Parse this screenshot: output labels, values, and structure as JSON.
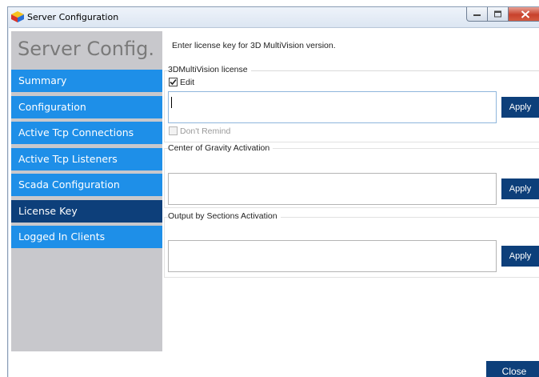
{
  "window": {
    "title": "Server Configuration"
  },
  "sidebar": {
    "title": "Server Config.",
    "items": [
      {
        "label": "Summary"
      },
      {
        "label": "Configuration"
      },
      {
        "label": "Active Tcp Connections"
      },
      {
        "label": "Active Tcp Listeners"
      },
      {
        "label": "Scada Configuration"
      },
      {
        "label": "License Key",
        "active": true
      },
      {
        "label": "Logged In Clients"
      }
    ]
  },
  "main": {
    "intro": "Enter license key for 3D MultiVision version.",
    "license_group": {
      "title": "3DMultiVision license",
      "edit_label": "Edit",
      "edit_checked": true,
      "license_value": "",
      "apply_label": "Apply",
      "dont_remind_label": "Don't Remind",
      "dont_remind_checked": false
    },
    "cog_group": {
      "title": "Center of Gravity Activation",
      "value": "",
      "apply_label": "Apply"
    },
    "output_group": {
      "title": "Output by Sections Activation",
      "value": "",
      "apply_label": "Apply"
    },
    "close_label": "Close"
  },
  "colors": {
    "accent": "#1e8fe8",
    "active": "#0d3f7a",
    "sidebar_bg": "#c8c8cc"
  }
}
